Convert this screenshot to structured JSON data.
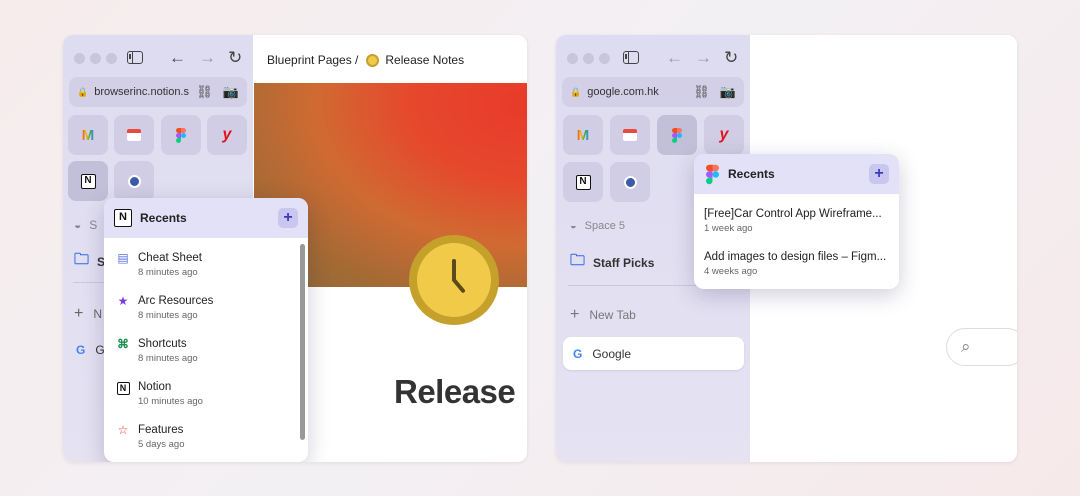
{
  "left_window": {
    "url": "browserinc.notion.s",
    "breadcrumb": {
      "parent": "Blueprint Pages /",
      "page": "Release Notes"
    },
    "page_heading": "Release",
    "sidebar_partial": {
      "space": "S",
      "folder": "S",
      "newtab": "N",
      "google": "G"
    },
    "popup": {
      "title": "Recents",
      "add": "+",
      "items": [
        {
          "title": "Cheat Sheet",
          "time": "8 minutes ago",
          "icon": "document-icon"
        },
        {
          "title": "Arc Resources",
          "time": "8 minutes ago",
          "icon": "star-icon"
        },
        {
          "title": "Shortcuts",
          "time": "8 minutes ago",
          "icon": "command-icon"
        },
        {
          "title": "Notion",
          "time": "10 minutes ago",
          "icon": "notion-icon"
        },
        {
          "title": "Features",
          "time": "5 days ago",
          "icon": "star-outline-icon"
        }
      ]
    }
  },
  "right_window": {
    "url": "google.com.hk",
    "space_label": "Space 5",
    "folder_label": "Staff Picks",
    "new_tab_label": "New Tab",
    "tab_label": "Google",
    "popup": {
      "title": "Recents",
      "add": "+",
      "items": [
        {
          "title": "[Free]Car Control App Wireframe...",
          "time": "1 week ago"
        },
        {
          "title": "Add images to design files – Figm...",
          "time": "4 weeks ago"
        }
      ]
    }
  },
  "glyphs": {
    "back": "←",
    "forward": "→",
    "reload": "↻",
    "lock": "🔒",
    "link": "⛓",
    "camera": "📷",
    "gmail": "M",
    "y": "y",
    "notion": "N",
    "folder": "🗀",
    "plus": "+",
    "g": "G",
    "search": "⌕",
    "doc": "▤",
    "star": "★",
    "cmd": "⌘",
    "star_outline": "☆",
    "planet": "◒"
  },
  "colors": {
    "accent": "#3b3bb8",
    "sidebar": "#dedcf0",
    "popup_header": "#e3e1f7"
  }
}
